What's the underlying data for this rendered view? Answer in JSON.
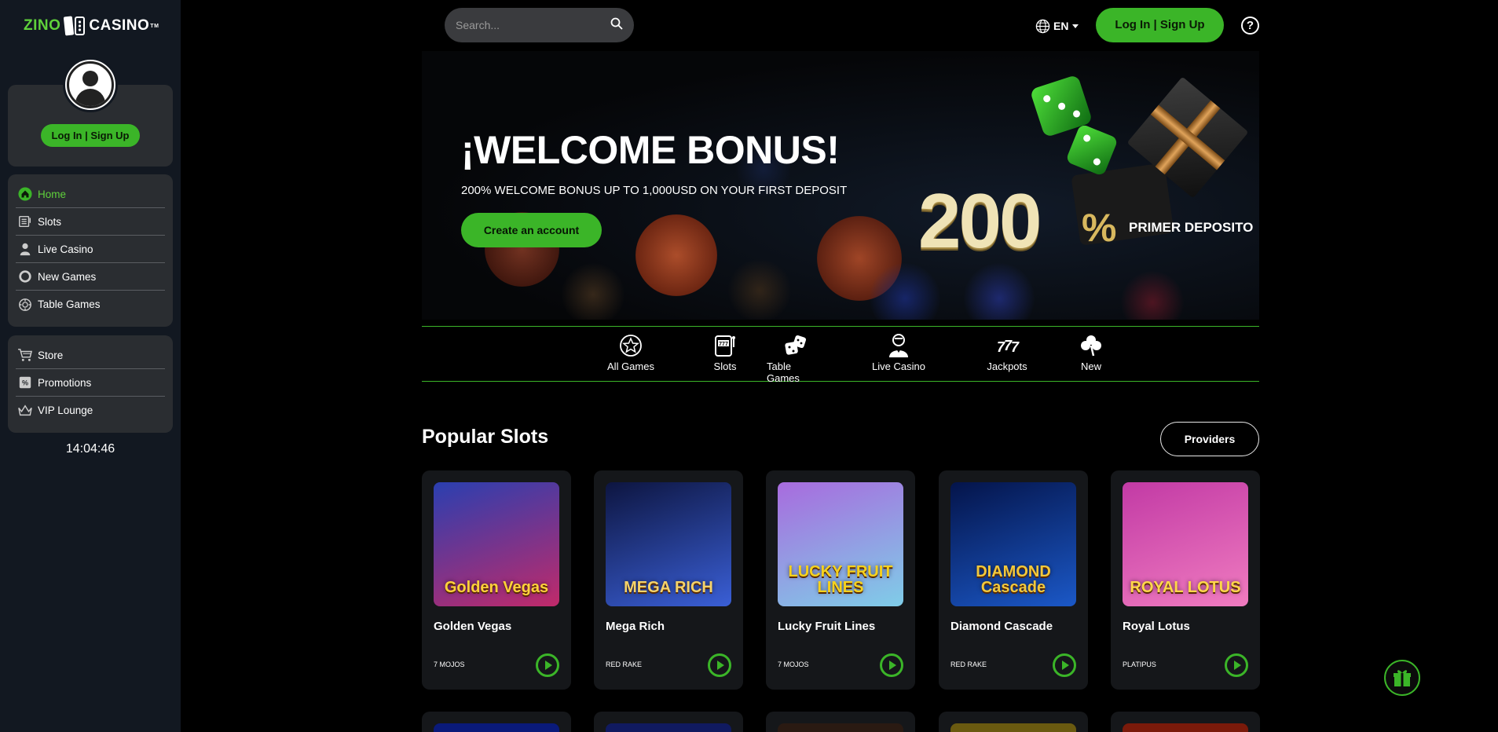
{
  "brand": {
    "logo_left": "ZINO",
    "logo_right": "CASINO",
    "trademark": "TM"
  },
  "sidebar": {
    "login_label": "Log In | Sign Up",
    "main_items": [
      {
        "label": "Home",
        "icon": "home-icon",
        "active": true
      },
      {
        "label": "Slots",
        "icon": "slots-icon",
        "active": false
      },
      {
        "label": "Live Casino",
        "icon": "dealer-icon",
        "active": false
      },
      {
        "label": "New Games",
        "icon": "circle-icon",
        "active": false
      },
      {
        "label": "Table Games",
        "icon": "chip-icon",
        "active": false
      }
    ],
    "extra_items": [
      {
        "label": "Store",
        "icon": "cart-icon"
      },
      {
        "label": "Promotions",
        "icon": "promotions-icon"
      },
      {
        "label": "VIP Lounge",
        "icon": "crown-icon"
      }
    ],
    "clock": "14:04:46"
  },
  "header": {
    "search_placeholder": "Search...",
    "language": "EN",
    "login_label": "Log In | Sign Up",
    "help_symbol": "?"
  },
  "banner": {
    "title": "¡WELCOME BONUS!",
    "subtitle": "200% WELCOME BONUS UP TO 1,000USD ON YOUR FIRST DEPOSIT",
    "cta": "Create an account",
    "big_number": "200",
    "percent": "%",
    "promo_text": "PRIMER DEPOSITO"
  },
  "categories": [
    {
      "label": "All Games",
      "icon": "star-icon"
    },
    {
      "label": "Slots",
      "icon": "slot-machine-icon"
    },
    {
      "label": "Table Games",
      "icon": "dice-icon"
    },
    {
      "label": "Live Casino",
      "icon": "dealer-icon"
    },
    {
      "label": "Jackpots",
      "icon": "sevens-icon"
    },
    {
      "label": "New",
      "icon": "clover-icon"
    }
  ],
  "popular": {
    "title": "Popular Slots",
    "providers_label": "Providers",
    "games": [
      {
        "name": "Golden Vegas",
        "provider": "7 MOJOS",
        "thumb_text": "Golden Vegas",
        "colors": [
          "#2a3fb0",
          "#c12a6a"
        ],
        "text_color": "#ffd23a"
      },
      {
        "name": "Mega Rich",
        "provider": "RED RAKE",
        "thumb_text": "MEGA RICH",
        "colors": [
          "#0d1540",
          "#3a5fd6"
        ],
        "text_color": "#f5d36a"
      },
      {
        "name": "Lucky Fruit Lines",
        "provider": "7 MOJOS",
        "thumb_text": "LUCKY FRUIT LINES",
        "colors": [
          "#a86bde",
          "#7fcde8"
        ],
        "text_color": "#f6d21e"
      },
      {
        "name": "Diamond Cascade",
        "provider": "RED RAKE",
        "thumb_text": "DIAMOND Cascade",
        "colors": [
          "#04144a",
          "#1b58c7"
        ],
        "text_color": "#f2c83c"
      },
      {
        "name": "Royal Lotus",
        "provider": "PLATIPUS",
        "thumb_text": "ROYAL LOTUS",
        "colors": [
          "#c23aa5",
          "#f07cc0"
        ],
        "text_color": "#ffd74a"
      }
    ]
  },
  "second_row_colors": [
    "#0a1a7a",
    "#101a60",
    "#2a1a12",
    "#6a5a10",
    "#7a1a0a"
  ],
  "colors": {
    "accent": "#3bb528",
    "sidebar_bg": "#121821",
    "card_bg": "#2a2d31"
  }
}
